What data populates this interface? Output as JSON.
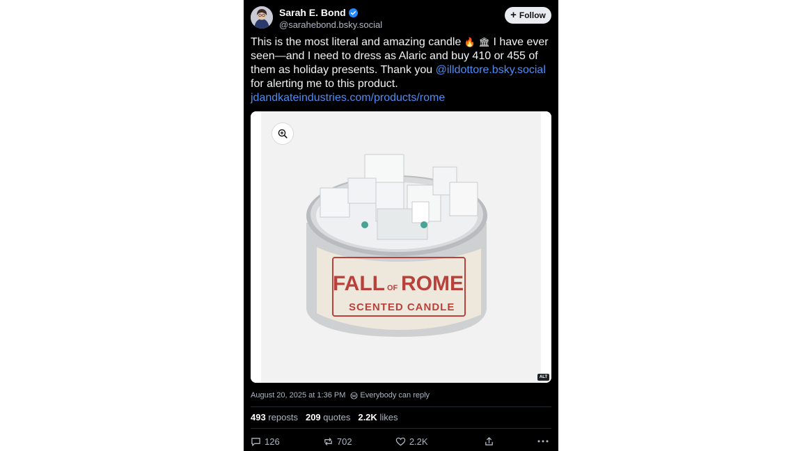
{
  "author": {
    "name": "Sarah E. Bond",
    "handle": "@sarahebond.bsky.social",
    "verified": true
  },
  "follow_label": "Follow",
  "post": {
    "text_part1": "This is the most literal and amazing candle",
    "emoji1": "🔥",
    "emoji2": "🏛",
    "text_part2": "I have ever seen—and I need to dress as Alaric and buy 410 or 455 of them as holiday presents. Thank you",
    "mention": "@illdottore.bsky.social",
    "text_part3": "for alerting me to this product.",
    "link": "jdandkateindustries.com/products/rome"
  },
  "image": {
    "label_line1_left": "FALL",
    "label_line1_mid": "OF",
    "label_line1_right": "ROME",
    "label_line2": "SCENTED CANDLE",
    "alt_badge": "ALT"
  },
  "meta": {
    "timestamp": "August 20, 2025 at 1:36 PM",
    "reply_setting": "Everybody can reply"
  },
  "stats": {
    "reposts_count": "493",
    "reposts_label": "reposts",
    "quotes_count": "209",
    "quotes_label": "quotes",
    "likes_count": "2.2K",
    "likes_label": "likes"
  },
  "actions": {
    "replies": "126",
    "reposts": "702",
    "likes": "2.2K"
  },
  "colors": {
    "background": "#000000",
    "link": "#4d8df6",
    "verified": "#1f8bff",
    "label_red": "#b8413c"
  },
  "icons": [
    "verified-check-icon",
    "plus-icon",
    "zoom-in-icon",
    "globe-icon",
    "reply-icon",
    "repost-icon",
    "heart-icon",
    "share-icon",
    "more-icon"
  ]
}
